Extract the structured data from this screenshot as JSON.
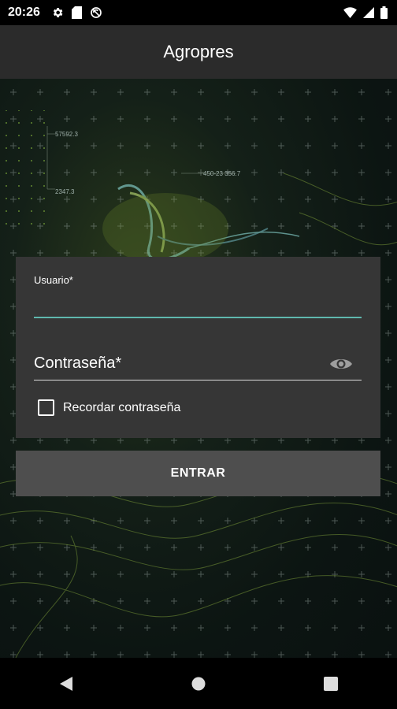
{
  "status_bar": {
    "time": "20:26",
    "icons_left": [
      "gear-icon",
      "sd-card-icon",
      "sync-off-icon"
    ],
    "icons_right": [
      "wifi-icon",
      "signal-icon",
      "battery-icon"
    ]
  },
  "app_bar": {
    "title": "Agropres"
  },
  "background": {
    "labels": [
      "57592.3",
      "2347.3",
      "450-23 356.7"
    ]
  },
  "login_form": {
    "username_label": "Usuario*",
    "username_value": "",
    "password_label": "Contraseña*",
    "password_value": "",
    "remember_label": "Recordar contraseña",
    "remember_checked": false
  },
  "enter_button": {
    "label": "ENTRAR"
  },
  "nav_bar": {
    "items": [
      "back-icon",
      "home-icon",
      "recents-icon"
    ]
  },
  "colors": {
    "accent": "#5fb8ae",
    "card": "#363636",
    "button": "#4e4e4e",
    "appbar": "#2b2b2b"
  }
}
